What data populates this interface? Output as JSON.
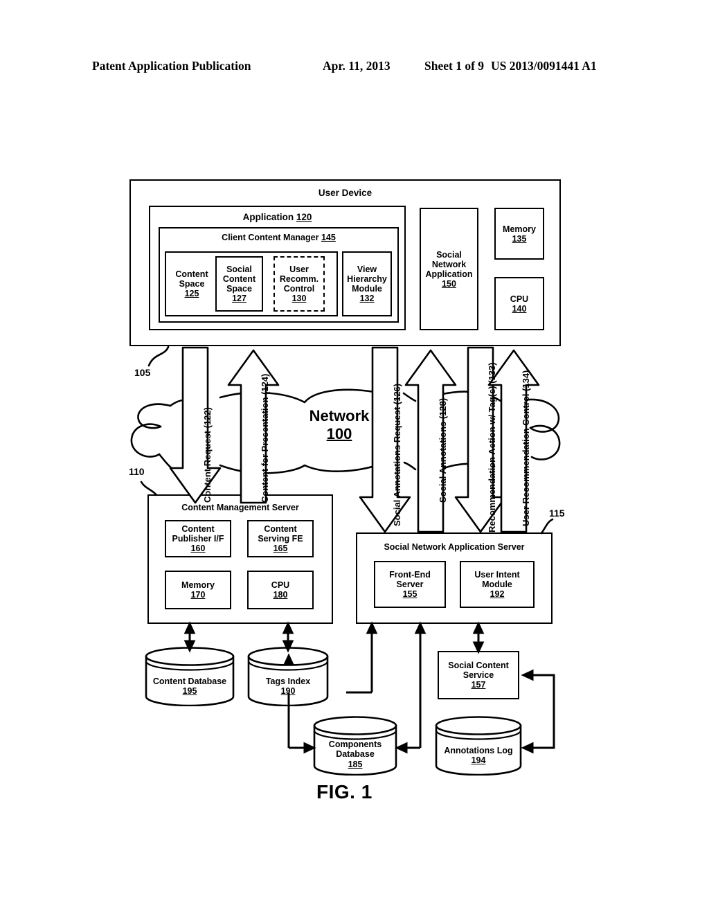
{
  "header": {
    "publication": "Patent Application Publication",
    "date": "Apr. 11, 2013",
    "sheet": "Sheet 1 of 9",
    "patent_number": "US 2013/0091441 A1"
  },
  "figure": {
    "caption": "FIG. 1",
    "user_device": {
      "title": "User Device",
      "application": {
        "title": "Application",
        "ref": "120",
        "client_content_manager": {
          "title": "Client Content Manager",
          "ref": "145",
          "content_space": {
            "line1": "Content",
            "line2": "Space",
            "ref": "125"
          },
          "social_content_space": {
            "line1": "Social",
            "line2": "Content",
            "line3": "Space",
            "ref": "127"
          },
          "user_recomm_control": {
            "line1": "User",
            "line2": "Recomm.",
            "line3": "Control",
            "ref": "130"
          },
          "view_hierarchy_module": {
            "line1": "View",
            "line2": "Hierarchy",
            "line3": "Module",
            "ref": "132"
          }
        }
      },
      "social_network_application": {
        "line1": "Social",
        "line2": "Network",
        "line3": "Application",
        "ref": "150"
      },
      "memory": {
        "line1": "Memory",
        "ref": "135"
      },
      "cpu": {
        "line1": "CPU",
        "ref": "140"
      }
    },
    "network": {
      "label": "Network",
      "ref": "100"
    },
    "flows": [
      {
        "id": "122",
        "label": "Content Request (122)",
        "direction": "down"
      },
      {
        "id": "124",
        "label": "Content for Presentation (124)",
        "direction": "up"
      },
      {
        "id": "126",
        "label": "Social Annotations Request (126)",
        "direction": "down"
      },
      {
        "id": "128",
        "label": "Social Annotations (128)",
        "direction": "up"
      },
      {
        "id": "133",
        "label": "Recommendation Action w/ Tag(s) (133)",
        "direction": "down"
      },
      {
        "id": "134",
        "label": "User Recommendation Control (134)",
        "direction": "up"
      }
    ],
    "content_management_server": {
      "title": "Content Management Server",
      "content_publisher_if": {
        "line1": "Content",
        "line2": "Publisher I/F",
        "ref": "160"
      },
      "content_serving_fe": {
        "line1": "Content",
        "line2": "Serving FE",
        "ref": "165"
      },
      "memory": {
        "line1": "Memory",
        "ref": "170"
      },
      "cpu": {
        "line1": "CPU",
        "ref": "180"
      }
    },
    "social_network_application_server": {
      "title": "Social Network Application Server",
      "front_end_server": {
        "line1": "Front-End",
        "line2": "Server",
        "ref": "155"
      },
      "user_intent_module": {
        "line1": "User Intent",
        "line2": "Module",
        "ref": "192"
      }
    },
    "social_content_service": {
      "line1": "Social Content",
      "line2": "Service",
      "ref": "157"
    },
    "databases": {
      "content_database": {
        "label": "Content Database",
        "ref": "195"
      },
      "tags_index": {
        "label": "Tags Index",
        "ref": "190"
      },
      "components_database": {
        "line1": "Components",
        "line2": "Database",
        "ref": "185"
      },
      "annotations_log": {
        "label": "Annotations Log",
        "ref": "194"
      }
    },
    "reference_numerals": {
      "user_device": "105",
      "content_management_server": "110",
      "social_network_application_server": "115"
    }
  }
}
